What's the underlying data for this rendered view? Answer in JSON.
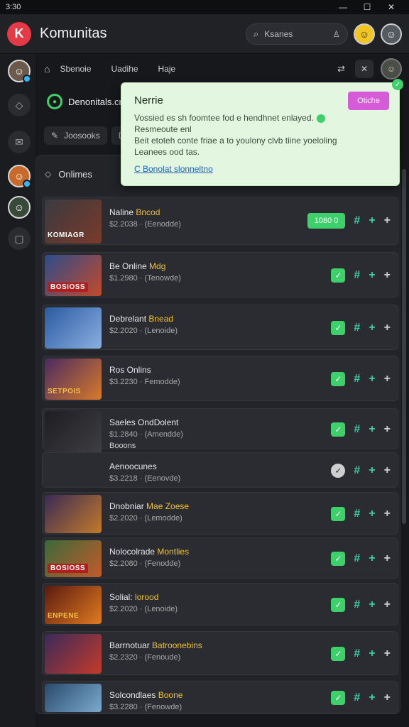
{
  "titlebar": {
    "time": "3:30",
    "minimize": "—",
    "maximize": "☐",
    "close": "✕"
  },
  "header": {
    "logo": "K",
    "app_title": "Komunitas",
    "search_placeholder": "Ksanes"
  },
  "subnav": {
    "tabs": [
      "Sbenoie",
      "Uadihe",
      "Haje"
    ]
  },
  "community": {
    "label": "Denonitals.cr"
  },
  "filters": [
    {
      "label": "Joosooks"
    },
    {
      "label": "D"
    }
  ],
  "panel": {
    "heading": "Onlimes"
  },
  "popup": {
    "title": "Nerrie",
    "button": "Otiche",
    "line1": "Vossied es sh foomtee fod e hendhnet enlayed.",
    "line2": "Resmeoute                    enl",
    "line3": "Beit etoteh conte friae a to  youlony clvb tiine  yoeloling",
    "line4": "Leanees ood tas.",
    "link": "C Bonolat slonneltno"
  },
  "games": [
    {
      "thumb_label": "KOMIAGR",
      "title_a": "Naline",
      "title_b": "Bncod",
      "sub1": "$2.2038  ·  (Eenodde)",
      "badge": "1080 0",
      "colors": [
        "#3a3a40",
        "#7a3a2a"
      ]
    },
    {
      "thumb_label": "BOSIOSS",
      "title_a": "Be Online",
      "title_b": "Mdg",
      "sub1": "$1.2980  ·  (Tenowde)",
      "colors": [
        "#2b4c8a",
        "#c44a2a"
      ]
    },
    {
      "thumb_label": "",
      "title_a": "Debrelant",
      "title_b": "Bnead",
      "sub1": "$2.2020  ·  (Lenoide)",
      "colors": [
        "#2a5aa0",
        "#8ab0e0"
      ]
    },
    {
      "thumb_label": "SETPOIS",
      "title_a": "Ros Onlins",
      "title_b": "",
      "sub1": "$3.2230  ·  Femodde)",
      "colors": [
        "#4a2a60",
        "#d87a2a"
      ]
    },
    {
      "thumb_label": "",
      "title_a": "Saeles OndDolent",
      "title_b": "",
      "sub1": "$1.2840  ·  (Amendde)",
      "sub2": "Booons",
      "colors": [
        "#1e1e22",
        "#4a4a4e"
      ]
    },
    {
      "thumb_label": "",
      "title_a": "Aenoocunes",
      "title_b": "",
      "sub1": "$3.2218  ·  (Eenovde)",
      "chk_gray": true,
      "hidden_thumb": true
    },
    {
      "thumb_label": "",
      "title_a": "Dnobniar",
      "title_b": "Mae Zoese",
      "sub1": "$2.2020  ·  (Lemodde)",
      "colors": [
        "#3a2a55",
        "#c47a2a"
      ]
    },
    {
      "thumb_label": "BOSIOSS",
      "title_a": "Nolocolrade",
      "title_b": "Montlies",
      "sub1": "$2.2080  ·  (Fenodde)",
      "colors": [
        "#3a6a3a",
        "#c45a2a"
      ]
    },
    {
      "thumb_label": "ENPENE",
      "title_a": "Solial:",
      "title_b": "lorood",
      "sub1": "$2.2020  ·  (Lenoide)",
      "colors": [
        "#5a1a10",
        "#e07a20"
      ]
    },
    {
      "thumb_label": "",
      "title_a": "Barrnotuar",
      "title_b": "Batroonebins",
      "sub1": "$2.2320  ·  (Fenoude)",
      "colors": [
        "#3a2a5a",
        "#c43a2a"
      ]
    },
    {
      "thumb_label": "",
      "title_a": "Solcondlaes",
      "title_b": "Boone",
      "sub1": "$3.2280  ·  (Fenowde)",
      "colors": [
        "#2a4a6a",
        "#7aaad0"
      ]
    }
  ]
}
